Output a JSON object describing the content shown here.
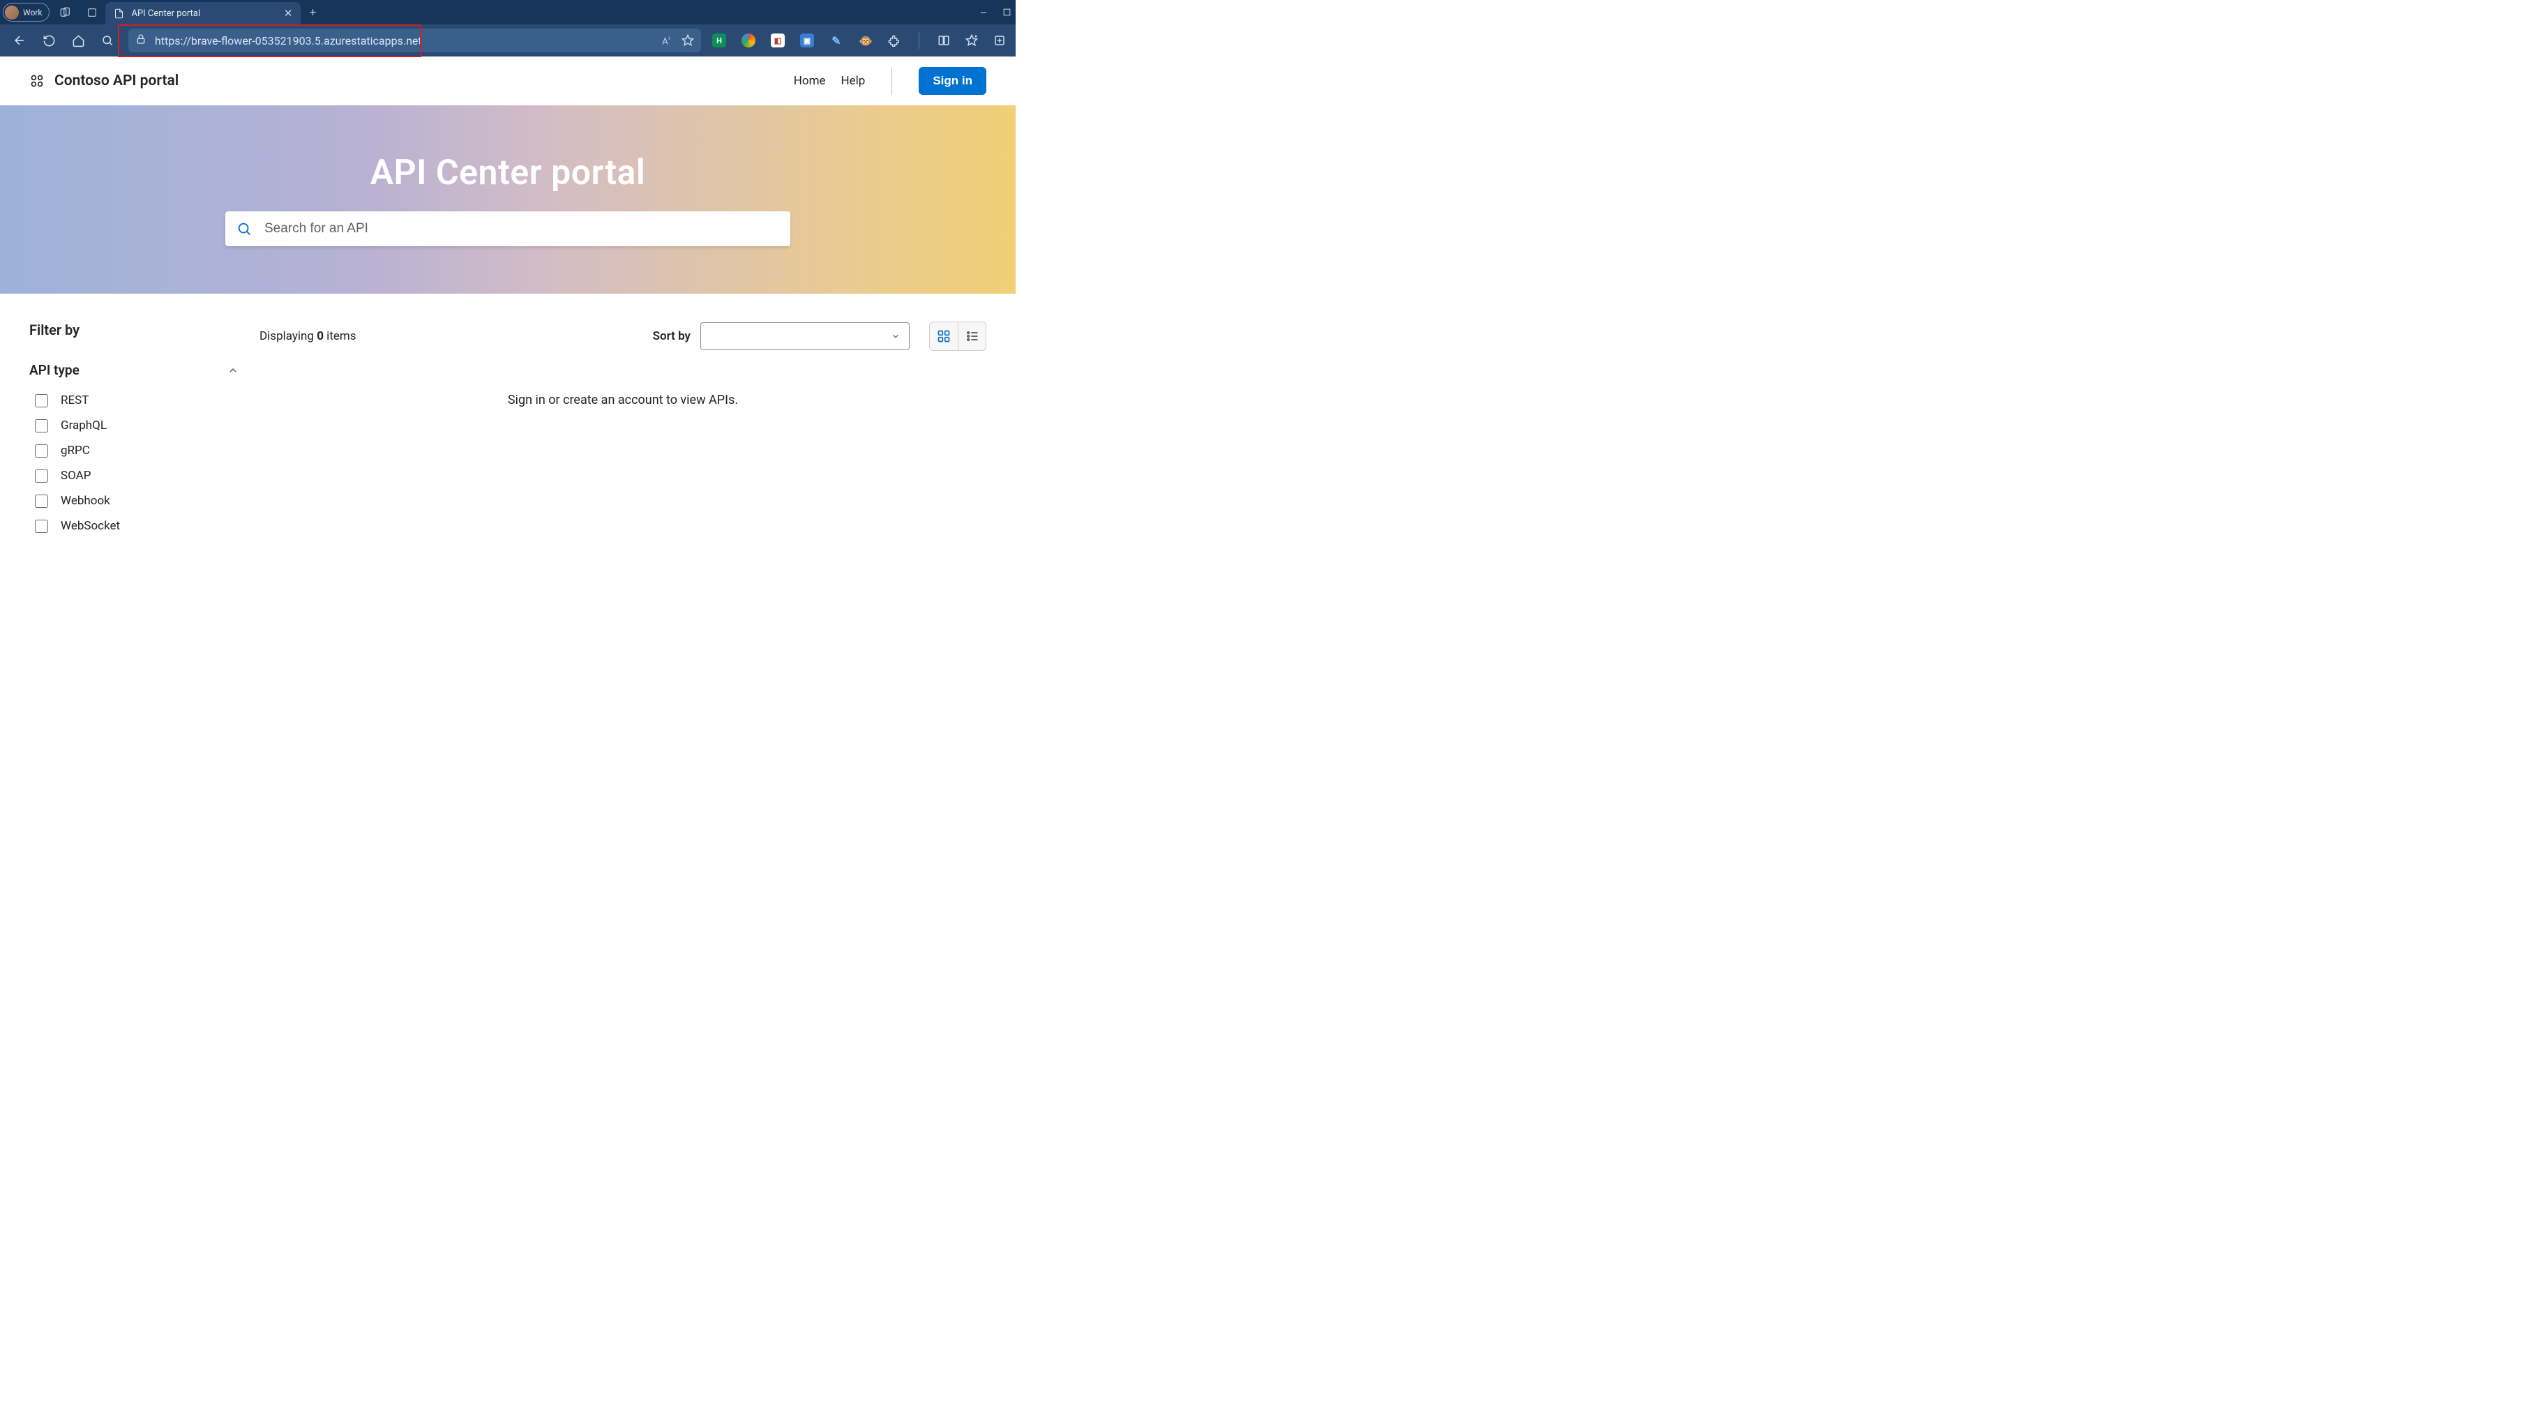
{
  "browser": {
    "profile_label": "Work",
    "tab_title": "API Center portal",
    "url": "https://brave-flower-053521903.5.azurestaticapps.net"
  },
  "header": {
    "brand": "Contoso API portal",
    "nav_home": "Home",
    "nav_help": "Help",
    "signin": "Sign in"
  },
  "hero": {
    "title": "API Center portal",
    "search_placeholder": "Search for an API"
  },
  "filter": {
    "heading": "Filter by",
    "group": "API type",
    "options": [
      "REST",
      "GraphQL",
      "gRPC",
      "SOAP",
      "Webhook",
      "WebSocket"
    ]
  },
  "results": {
    "displaying_prefix": "Displaying ",
    "count": "0",
    "displaying_suffix": " items",
    "sort_label": "Sort by",
    "sort_value": "",
    "empty_message": "Sign in or create an account to view APIs."
  }
}
